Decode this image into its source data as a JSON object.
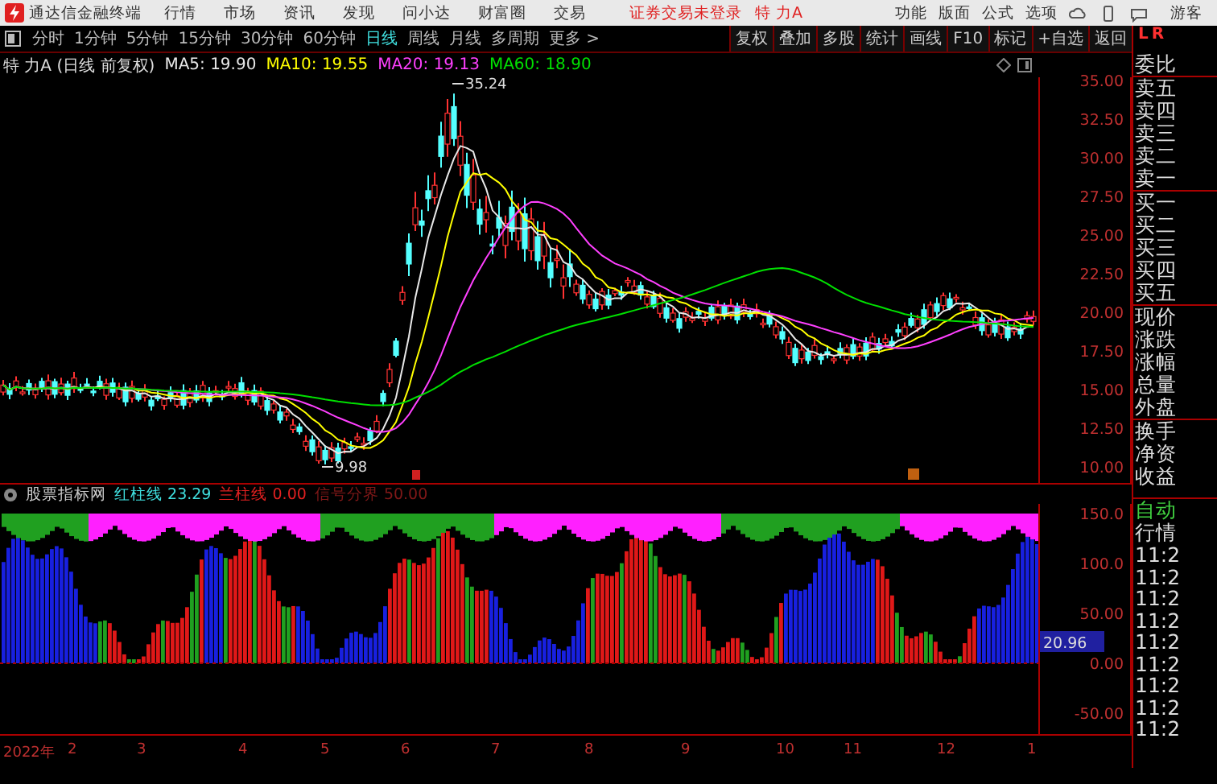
{
  "title_bar": {
    "app_name": "通达信金融终端",
    "menus": [
      "行情",
      "市场",
      "资讯",
      "发现",
      "问小达",
      "财富圈",
      "交易"
    ],
    "login_status": "证券交易未登录",
    "stock_name": "特 力A",
    "right_menus": [
      "功能",
      "版面",
      "公式",
      "选项"
    ],
    "user": "游客"
  },
  "period_tabs": [
    {
      "label": "分时",
      "selected": false
    },
    {
      "label": "1分钟",
      "selected": false
    },
    {
      "label": "5分钟",
      "selected": false
    },
    {
      "label": "15分钟",
      "selected": false
    },
    {
      "label": "30分钟",
      "selected": false
    },
    {
      "label": "60分钟",
      "selected": false
    },
    {
      "label": "日线",
      "selected": true
    },
    {
      "label": "周线",
      "selected": false
    },
    {
      "label": "月线",
      "selected": false
    },
    {
      "label": "多周期",
      "selected": false
    },
    {
      "label": "更多 >",
      "selected": false
    }
  ],
  "tool_buttons": [
    "复权",
    "叠加",
    "多股",
    "统计",
    "画线",
    "F10",
    "标记",
    "+自选",
    "返回"
  ],
  "chart_header": {
    "title": "特 力A (日线 前复权)",
    "ma": [
      {
        "label": "MA5: 19.90",
        "color": "#e8e8e8"
      },
      {
        "label": "MA10: 19.55",
        "color": "#ffff00"
      },
      {
        "label": "MA20: 19.13",
        "color": "#ff40ff"
      },
      {
        "label": "MA60: 18.90",
        "color": "#00e000"
      }
    ]
  },
  "price_chart": {
    "high_label": "35.24",
    "low_label": "9.98"
  },
  "price_axis": [
    "35.00",
    "32.50",
    "30.00",
    "27.50",
    "25.00",
    "22.50",
    "20.00",
    "17.50",
    "15.00",
    "12.50",
    "10.00"
  ],
  "quote_panel": {
    "badge_left": "L",
    "badge_right": "R",
    "labels": [
      "委比",
      "卖五",
      "卖四",
      "卖三",
      "卖二",
      "卖一",
      "买一",
      "买二",
      "买三",
      "买四",
      "买五",
      "现价",
      "涨跌",
      "涨幅",
      "总量",
      "外盘",
      "换手",
      "净资",
      "收益"
    ]
  },
  "indicator": {
    "name": "股票指标网",
    "series": [
      {
        "label": "红柱线",
        "value": "23.29",
        "color": "#40e0e0"
      },
      {
        "label": "兰柱线",
        "value": "0.00",
        "color": "#e02020"
      },
      {
        "label": "信号分界",
        "value": "50.00",
        "color": "#801818"
      }
    ]
  },
  "indicator_axis": [
    "150.0",
    "100.0",
    "50.00",
    "0.00",
    "-50.00"
  ],
  "indicator_current": "20.96",
  "trade_panel": {
    "mode": "自动",
    "title": "行情",
    "times": [
      "11:2",
      "11:2",
      "11:2",
      "11:2",
      "11:2",
      "11:2",
      "11:2",
      "11:2",
      "11:2"
    ]
  },
  "date_axis": [
    "2022年",
    "2",
    "3",
    "4",
    "5",
    "6",
    "7",
    "8",
    "9",
    "10",
    "11",
    "12",
    "1"
  ]
}
